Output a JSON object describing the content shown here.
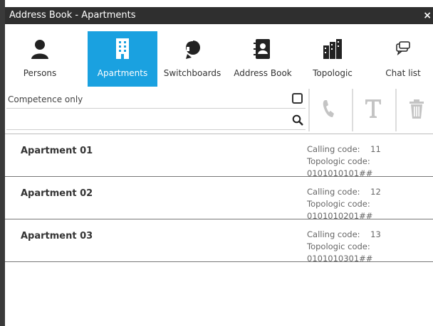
{
  "window": {
    "title": "Address Book - Apartments",
    "close_glyph": "×"
  },
  "nav": [
    {
      "label": "Persons",
      "icon": "person-icon",
      "active": false
    },
    {
      "label": "Apartments",
      "icon": "building-icon",
      "active": true
    },
    {
      "label": "Switchboards",
      "icon": "headset-icon",
      "active": false
    },
    {
      "label": "Address Book",
      "icon": "address-book-icon",
      "active": false
    },
    {
      "label": "Topologic",
      "icon": "topology-icon",
      "active": false
    },
    {
      "label": "Chat list",
      "icon": "chat-icon",
      "active": false
    }
  ],
  "filters": {
    "competence_label": "Competence only",
    "competence_checked": false,
    "search_value": ""
  },
  "toolbar": {
    "call_icon": "phone-icon",
    "text_icon": "text-icon",
    "delete_icon": "trash-icon"
  },
  "apartments": [
    {
      "name": "Apartment 01",
      "calling_label": "Calling code:",
      "calling_code": "11",
      "topologic_label": "Topologic code:",
      "topologic_code": "0101010101##"
    },
    {
      "name": "Apartment 02",
      "calling_label": "Calling code:",
      "calling_code": "12",
      "topologic_label": "Topologic code:",
      "topologic_code": "0101010201##"
    },
    {
      "name": "Apartment 03",
      "calling_label": "Calling code:",
      "calling_code": "13",
      "topologic_label": "Topologic code:",
      "topologic_code": "0101010301##"
    }
  ],
  "colors": {
    "accent": "#1aa1e0",
    "titlebar": "#2f2f2f",
    "icon_disabled": "#c4c4c4"
  }
}
